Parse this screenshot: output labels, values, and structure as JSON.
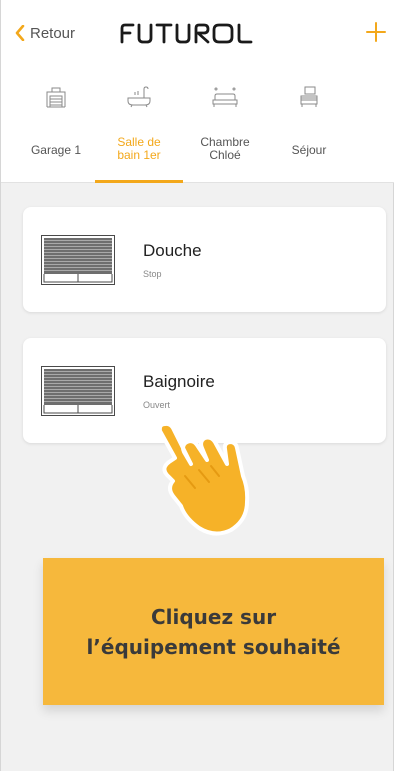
{
  "header": {
    "back_label": "Retour",
    "logo_text": "FUTUROL",
    "add_icon": "plus-icon"
  },
  "colors": {
    "accent": "#f3a81b",
    "callout_bg": "#f6b83c",
    "page_bg": "#f1f1f1"
  },
  "tabs": [
    {
      "label": "Garage 1",
      "icon": "garage-icon",
      "active": false
    },
    {
      "label": "Salle de\nbain 1er",
      "icon": "bathtub-icon",
      "active": true
    },
    {
      "label": "Chambre\nChloé",
      "icon": "bed-icon",
      "active": false
    },
    {
      "label": "Séjour",
      "icon": "living-room-icon",
      "active": false
    }
  ],
  "devices": [
    {
      "name": "Douche",
      "status": "Stop",
      "icon": "shutter-icon"
    },
    {
      "name": "Baignoire",
      "status": "Ouvert",
      "icon": "shutter-icon"
    }
  ],
  "callout": {
    "line1": "Cliquez sur",
    "line2": "l’équipement souhaité"
  }
}
